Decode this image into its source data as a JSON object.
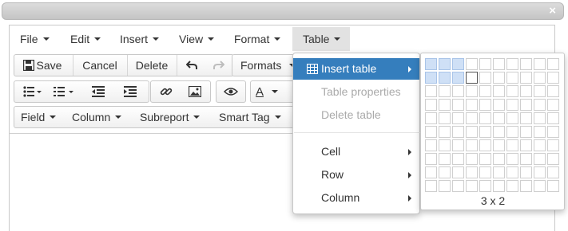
{
  "window": {
    "close_glyph": "×"
  },
  "menubar": {
    "items": [
      {
        "label": "File"
      },
      {
        "label": "Edit"
      },
      {
        "label": "Insert"
      },
      {
        "label": "View"
      },
      {
        "label": "Format"
      },
      {
        "label": "Table"
      }
    ],
    "active": "Table"
  },
  "toolbar1": {
    "save": "Save",
    "cancel": "Cancel",
    "delete": "Delete",
    "undo_icon": "undo-icon",
    "redo_icon": "redo-icon",
    "formats": "Formats"
  },
  "toolbar2": {
    "icons": [
      "bullet-list-icon",
      "numbered-list-icon",
      "outdent-icon",
      "indent-icon",
      "link-icon",
      "image-icon",
      "preview-icon",
      "text-color-icon"
    ],
    "text_color_glyph": "A"
  },
  "toolbar3": {
    "field": "Field",
    "column": "Column",
    "subreport": "Subreport",
    "smart_tag": "Smart Tag"
  },
  "table_menu": {
    "items": [
      {
        "label": "Insert table",
        "state": "active",
        "submenu": true
      },
      {
        "label": "Table properties",
        "state": "disabled",
        "submenu": false
      },
      {
        "label": "Delete table",
        "state": "disabled",
        "submenu": false
      },
      {
        "label": "Cell",
        "state": "normal",
        "submenu": true
      },
      {
        "label": "Row",
        "state": "normal",
        "submenu": true
      },
      {
        "label": "Column",
        "state": "normal",
        "submenu": true
      }
    ]
  },
  "table_grid": {
    "columns": 10,
    "rows": 10,
    "selected_cols": 3,
    "selected_rows": 2,
    "size_label": "3 x 2",
    "colors": {
      "selected": "#cfe0f6",
      "accent": "#357ebd"
    }
  }
}
